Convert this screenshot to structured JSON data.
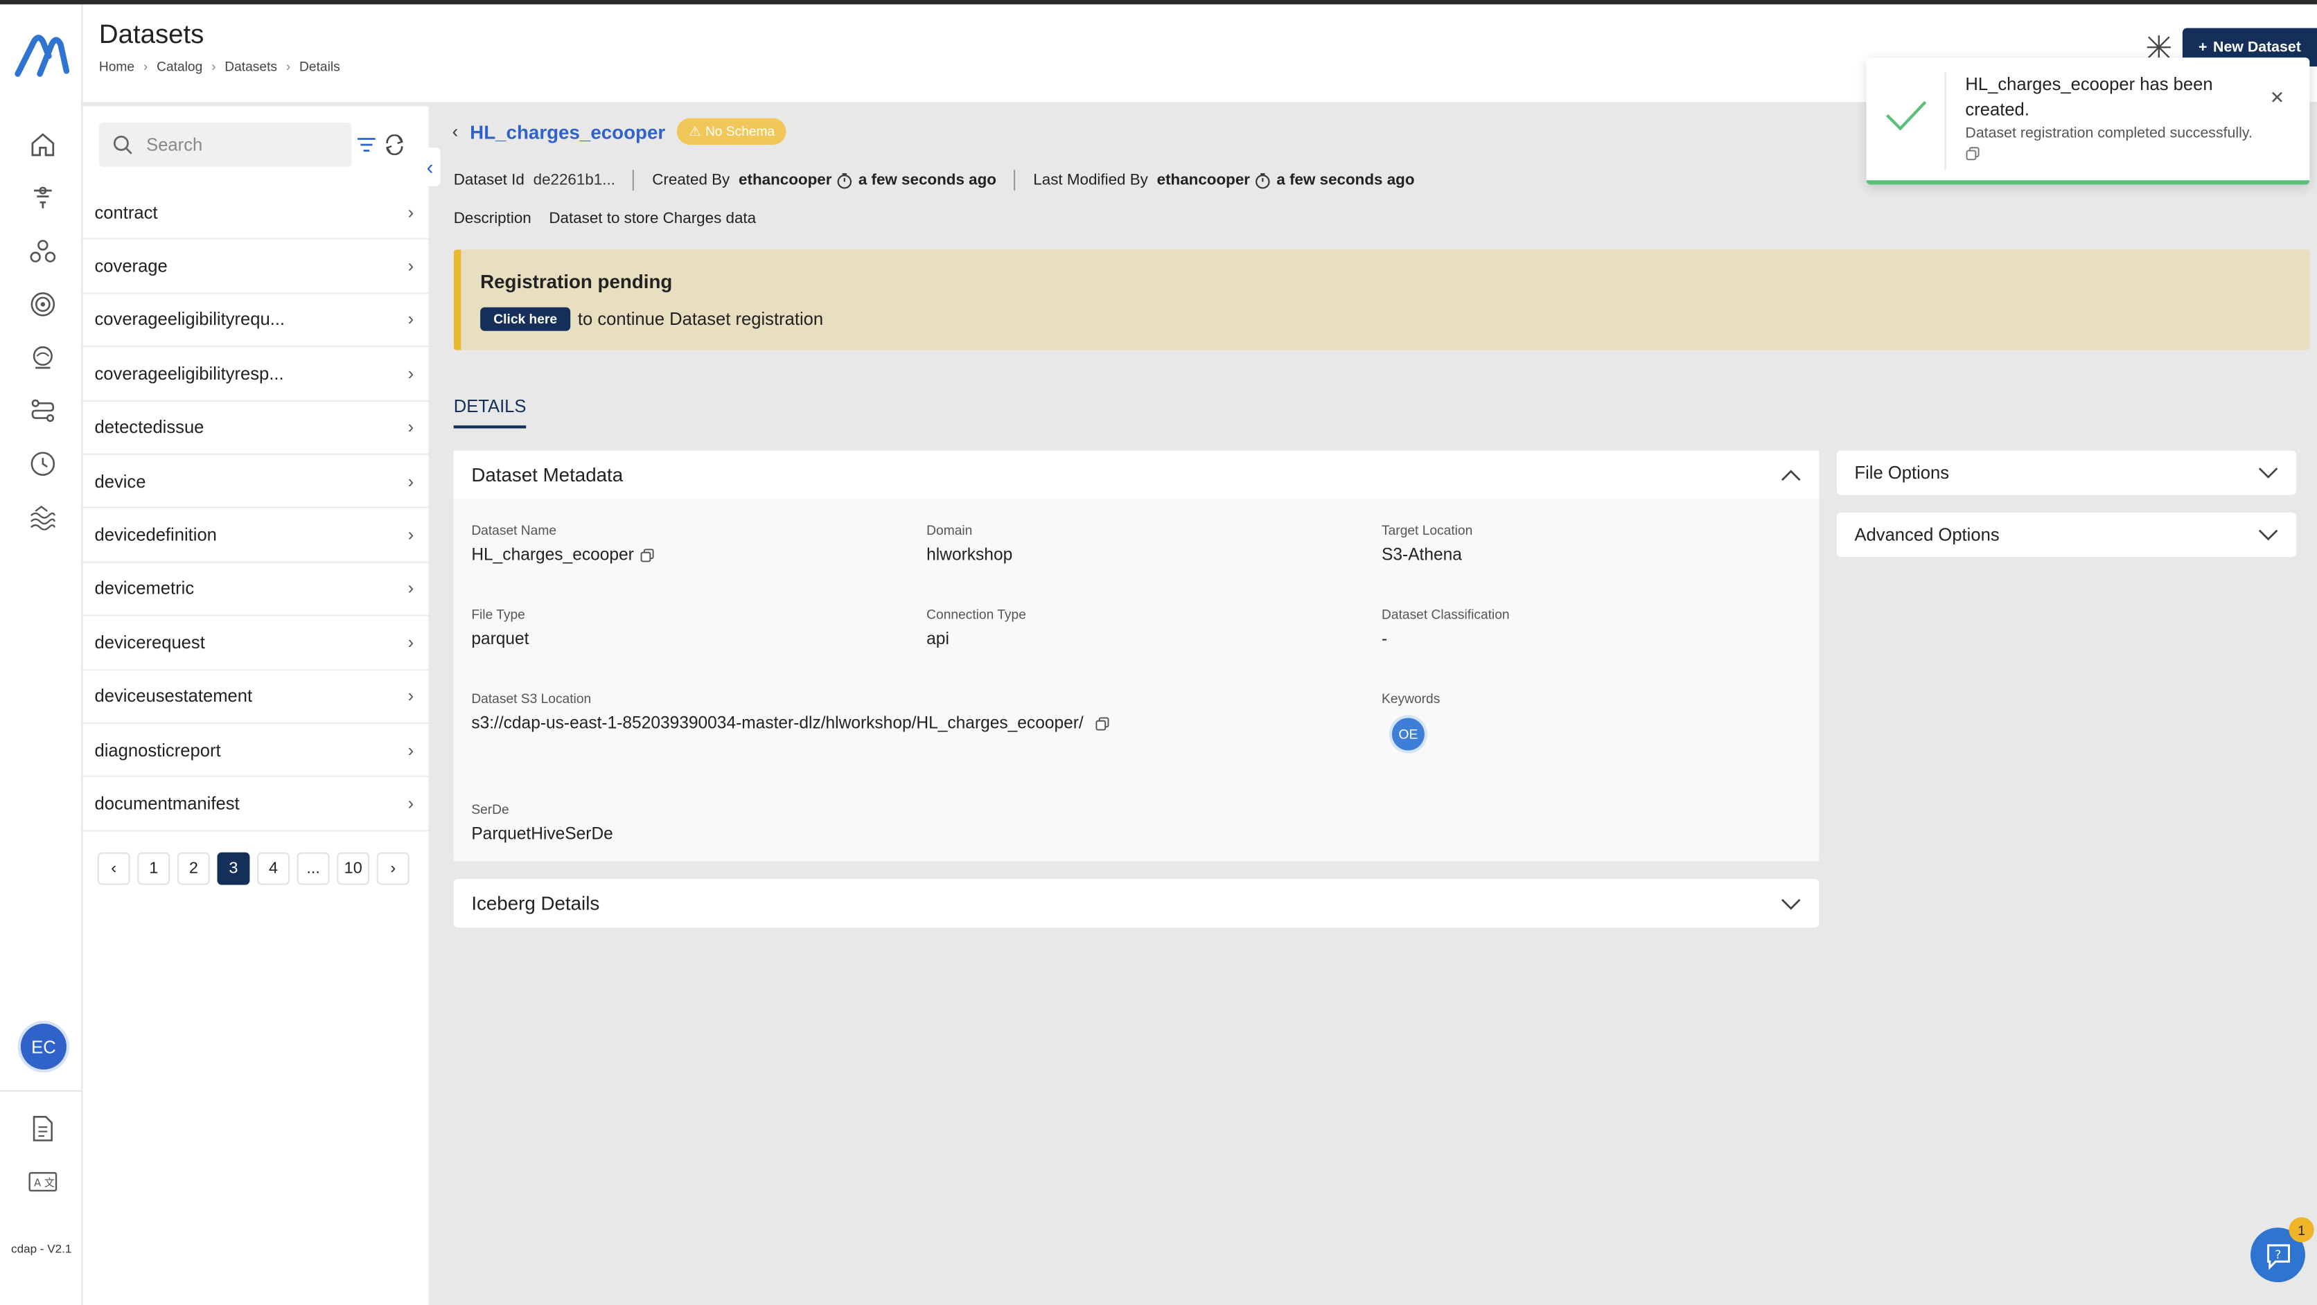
{
  "app": {
    "version": "cdap - V2.1",
    "user_initials": "EC"
  },
  "header": {
    "title": "Datasets",
    "breadcrumbs": [
      "Home",
      "Catalog",
      "Datasets",
      "Details"
    ],
    "new_dataset_label": "New Dataset"
  },
  "sidebar": {
    "icons": [
      "home-icon",
      "funnel-icon",
      "cluster-icon",
      "target-icon",
      "globe-icon",
      "pipeline-icon",
      "clock-icon",
      "waves-icon"
    ],
    "bottom_icons": [
      "document-icon",
      "translate-icon"
    ]
  },
  "list_panel": {
    "search_placeholder": "Search",
    "items": [
      {
        "label": "contract"
      },
      {
        "label": "coverage"
      },
      {
        "label": "coverageeligibilityrequ..."
      },
      {
        "label": "coverageeligibilityresp..."
      },
      {
        "label": "detectedissue"
      },
      {
        "label": "device"
      },
      {
        "label": "devicedefinition"
      },
      {
        "label": "devicemetric"
      },
      {
        "label": "devicerequest"
      },
      {
        "label": "deviceusestatement"
      },
      {
        "label": "diagnosticreport"
      },
      {
        "label": "documentmanifest"
      }
    ],
    "pagination": {
      "pages": [
        "1",
        "2",
        "3",
        "4",
        "...",
        "10"
      ],
      "current": "3"
    }
  },
  "dataset": {
    "name": "HL_charges_ecooper",
    "schema_badge": "No Schema",
    "id_label": "Dataset Id",
    "id_value": "de2261b1...",
    "created_by_label": "Created By",
    "created_by": "ethancooper",
    "created_time": "a few seconds ago",
    "modified_by_label": "Last Modified By",
    "modified_by": "ethancooper",
    "modified_time": "a few seconds ago",
    "description_label": "Description",
    "description": "Dataset to store Charges data"
  },
  "banner": {
    "title": "Registration pending",
    "button_label": "Click here",
    "text": "to continue Dataset registration",
    "accent_color": "#e8b832"
  },
  "tabs": {
    "details": "DETAILS"
  },
  "metadata": {
    "title": "Dataset Metadata",
    "fields": {
      "dataset_name": {
        "label": "Dataset Name",
        "value": "HL_charges_ecooper"
      },
      "domain": {
        "label": "Domain",
        "value": "hlworkshop"
      },
      "target_location": {
        "label": "Target Location",
        "value": "S3-Athena"
      },
      "file_type": {
        "label": "File Type",
        "value": "parquet"
      },
      "connection_type": {
        "label": "Connection Type",
        "value": "api"
      },
      "classification": {
        "label": "Dataset Classification",
        "value": "-"
      },
      "s3_location": {
        "label": "Dataset S3 Location",
        "value": "s3://cdap-us-east-1-852039390034-master-dlz/hlworkshop/HL_charges_ecooper/"
      },
      "keywords": {
        "label": "Keywords",
        "value": "OE"
      },
      "serde": {
        "label": "SerDe",
        "value": "ParquetHiveSerDe"
      }
    }
  },
  "panels": {
    "iceberg": "Iceberg Details",
    "file_options": "File Options",
    "advanced_options": "Advanced Options"
  },
  "toast": {
    "title": "HL_charges_ecooper has been created.",
    "message": "Dataset registration completed successfully.",
    "status_color": "#5bbf7a"
  },
  "help": {
    "badge_count": "1"
  },
  "colors": {
    "primary": "#14305a",
    "link": "#2f63c9",
    "warning": "#f1c75a"
  }
}
